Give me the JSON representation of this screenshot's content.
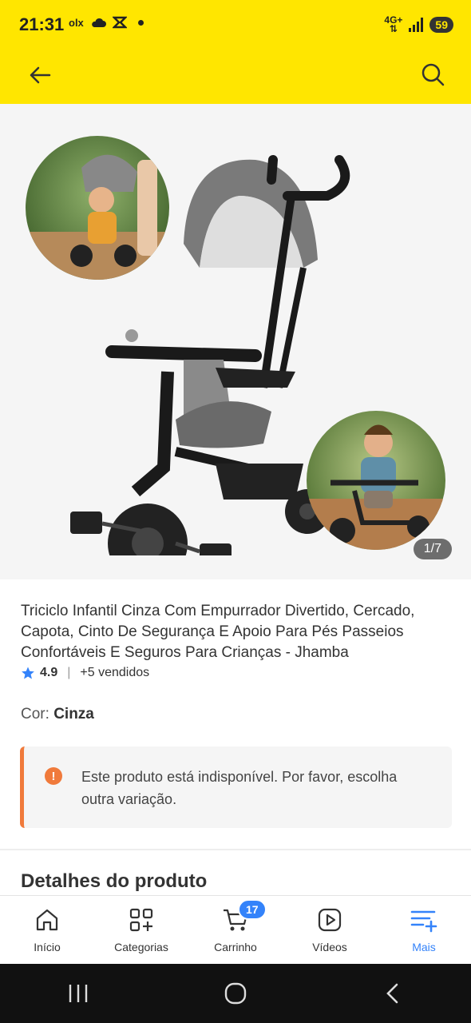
{
  "status_bar": {
    "time": "21:31",
    "left_icons": [
      "olx",
      "cloud-icon",
      "sync-icon"
    ],
    "network": "4G+",
    "battery": "59"
  },
  "header": {
    "back_icon": "arrow-left-icon",
    "search_icon": "search-icon"
  },
  "gallery": {
    "page_indicator": "1/7"
  },
  "product": {
    "title": "Triciclo Infantil Cinza Com Empurrador Divertido, Cercado, Capota, Cinto De Segurança E Apoio Para Pés Passeios Confortáveis E Seguros Para Crianças - Jhamba",
    "rating": "4.9",
    "sold": "+5 vendidos",
    "color_label": "Cor:",
    "color_value": "Cinza"
  },
  "notice": {
    "icon": "!",
    "text": "Este produto está indisponível. Por favor, escolha outra variação."
  },
  "details": {
    "title": "Detalhes do produto"
  },
  "bottom_nav": {
    "items": [
      {
        "label": "Início",
        "icon": "home-icon"
      },
      {
        "label": "Categorias",
        "icon": "categories-icon"
      },
      {
        "label": "Carrinho",
        "icon": "cart-icon",
        "badge": "17"
      },
      {
        "label": "Vídeos",
        "icon": "video-icon"
      },
      {
        "label": "Mais",
        "icon": "menu-plus-icon",
        "active": true
      }
    ]
  },
  "colors": {
    "header_yellow": "#FFE600",
    "accent_blue": "#3483FA",
    "warning_orange": "#F07A3B"
  }
}
